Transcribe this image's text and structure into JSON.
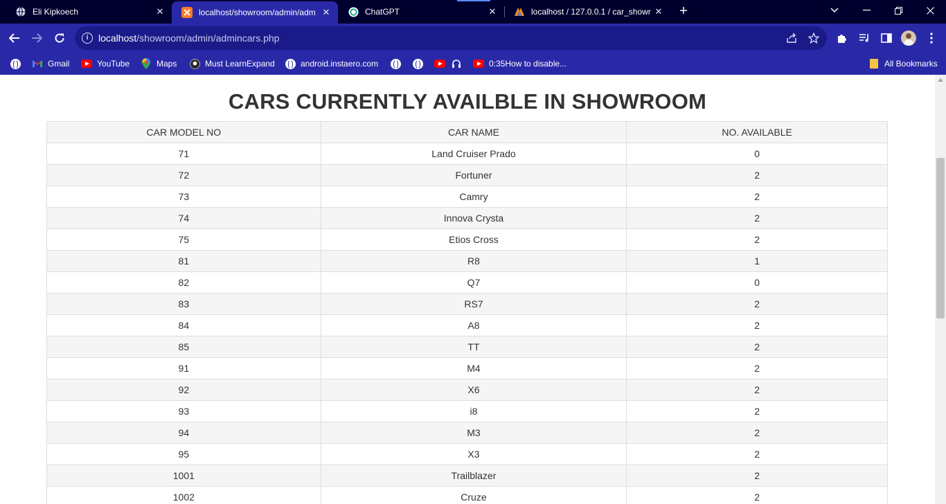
{
  "browser": {
    "tabs": [
      {
        "title": "Eli Kipkoech",
        "icon": "globe-icon",
        "active": false
      },
      {
        "title": "localhost/showroom/admin/adm",
        "icon": "xampp-icon",
        "active": true
      },
      {
        "title": "ChatGPT",
        "icon": "chatgpt-icon",
        "active": false
      },
      {
        "title": "localhost / 127.0.0.1 / car_showr",
        "icon": "phpmyadmin-icon",
        "active": false
      }
    ],
    "url": {
      "host": "localhost",
      "path": "/showroom/admin/admincars.php"
    },
    "bookmarks": [
      {
        "label": "",
        "icon": "globe-icon"
      },
      {
        "label": "Gmail",
        "icon": "gmail-icon"
      },
      {
        "label": "YouTube",
        "icon": "youtube-icon"
      },
      {
        "label": "Maps",
        "icon": "maps-icon"
      },
      {
        "label": "Must LearnExpand",
        "icon": "github-icon"
      },
      {
        "label": "android.instaero.com",
        "icon": "globe-icon"
      },
      {
        "label": "",
        "icon": "globe-icon"
      },
      {
        "label": "",
        "icon": "globe-icon"
      },
      {
        "label": "",
        "icon": "youtube-icon"
      },
      {
        "label": "",
        "icon": "headphones-icon"
      },
      {
        "label": "0:35How to disable...",
        "icon": "youtube-icon"
      }
    ],
    "all_bookmarks_label": "All Bookmarks"
  },
  "page": {
    "title": "CARS CURRENTLY AVAILBLE IN SHOWROOM",
    "table": {
      "headers": [
        "CAR MODEL NO",
        "CAR NAME",
        "NO. AVAILABLE"
      ],
      "rows": [
        [
          "71",
          "Land Cruiser Prado",
          "0"
        ],
        [
          "72",
          "Fortuner",
          "2"
        ],
        [
          "73",
          "Camry",
          "2"
        ],
        [
          "74",
          "Innova Crysta",
          "2"
        ],
        [
          "75",
          "Etios Cross",
          "2"
        ],
        [
          "81",
          "R8",
          "1"
        ],
        [
          "82",
          "Q7",
          "0"
        ],
        [
          "83",
          "RS7",
          "2"
        ],
        [
          "84",
          "A8",
          "2"
        ],
        [
          "85",
          "TT",
          "2"
        ],
        [
          "91",
          "M4",
          "2"
        ],
        [
          "92",
          "X6",
          "2"
        ],
        [
          "93",
          "i8",
          "2"
        ],
        [
          "94",
          "M3",
          "2"
        ],
        [
          "95",
          "X3",
          "2"
        ],
        [
          "1001",
          "Trailblazer",
          "2"
        ],
        [
          "1002",
          "Cruze",
          "2"
        ]
      ]
    }
  }
}
